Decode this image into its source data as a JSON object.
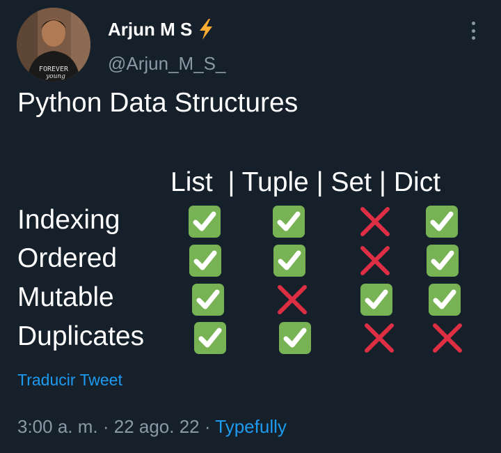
{
  "author": {
    "display_name": "Arjun M S",
    "badge_icon": "lightning-bolt-icon",
    "handle": "@Arjun_M_S_",
    "avatar_shirt_text": "FOREVER",
    "avatar_shirt_script": "young"
  },
  "tweet": {
    "title": "Python Data Structures",
    "table": {
      "header": "List  | Tuple | Set | Dict",
      "columns": [
        "List",
        "Tuple",
        "Set",
        "Dict"
      ],
      "rows": [
        {
          "label": "Indexing",
          "values": [
            "check",
            "check",
            "cross",
            "check"
          ]
        },
        {
          "label": "Ordered",
          "values": [
            "check",
            "check",
            "cross",
            "check"
          ]
        },
        {
          "label": "Mutable",
          "values": [
            "check",
            "cross",
            "check",
            "check"
          ]
        },
        {
          "label": "Duplicates",
          "values": [
            "check",
            "check",
            "cross",
            "cross"
          ]
        }
      ]
    }
  },
  "translate_label": "Traducir Tweet",
  "meta": {
    "time": "3:00 a. m.",
    "separator": " · ",
    "date": "22 ago. 22",
    "source": "Typefully"
  },
  "colors": {
    "background": "#15202b",
    "secondary_text": "#8b98a5",
    "link": "#1d9bf0",
    "check_green": "#77b255",
    "cross_red": "#dd2e44",
    "bolt_yellow": "#ffac33"
  }
}
